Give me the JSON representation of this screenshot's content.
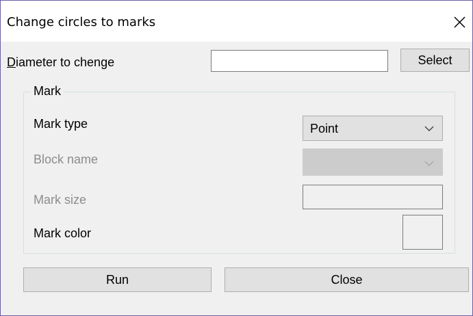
{
  "window": {
    "title": "Change circles to marks",
    "close_glyph": "×"
  },
  "diameter": {
    "label_mnemonic": "D",
    "label_rest": "iameter to chenge",
    "value": "",
    "placeholder": "",
    "select_label": "Select"
  },
  "mark_group": {
    "title": "Mark",
    "mark_type_label": "Mark type",
    "mark_type_value": "Point",
    "block_name_label": "Block name",
    "block_name_value": "",
    "mark_size_label": "Mark size",
    "mark_size_value": "",
    "mark_color_label": "Mark color",
    "mark_color_value": "#f0f0f0"
  },
  "buttons": {
    "run": "Run",
    "close": "Close"
  },
  "icons": {
    "close": "close-icon",
    "dropdown": "chevron-down-icon"
  },
  "colors": {
    "window_border": "#6b5ca5",
    "dialog_bg": "#f0f0f0",
    "disabled_text": "#8c8c8c"
  }
}
